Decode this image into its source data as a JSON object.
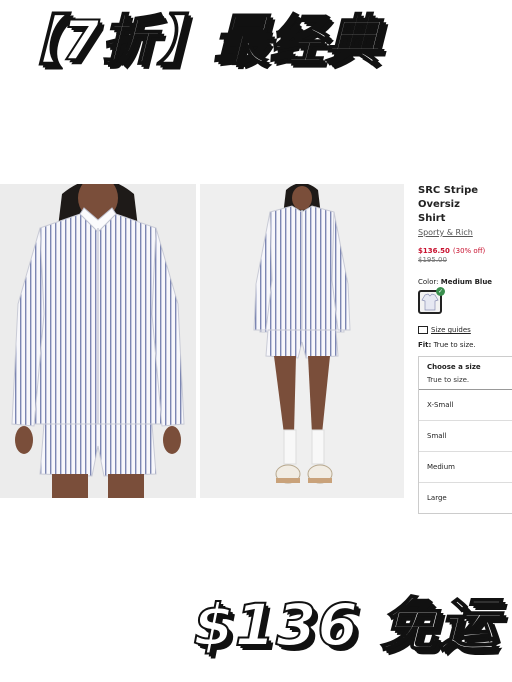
{
  "banner": {
    "title": "【7折】最经典",
    "price_tag": "$136 免运"
  },
  "product": {
    "name": "SRC Stripe Oversiz\nShirt",
    "brand": "Sporty & Rich",
    "sale_price": "$136.50",
    "discount": "(30% off)",
    "original_price": "$195.00",
    "color_label": "Color:",
    "color_value": "Medium Blue",
    "size_guide_label": "Size guides",
    "fit_label": "Fit:",
    "fit_value": "True to size.",
    "size_select": {
      "heading": "Choose a size",
      "subtext": "True to size.",
      "options": [
        "X-Small",
        "Small",
        "Medium",
        "Large"
      ]
    }
  },
  "colors": {
    "sale_red": "#c8102e",
    "stripe_blue": "#6f7aa8"
  }
}
